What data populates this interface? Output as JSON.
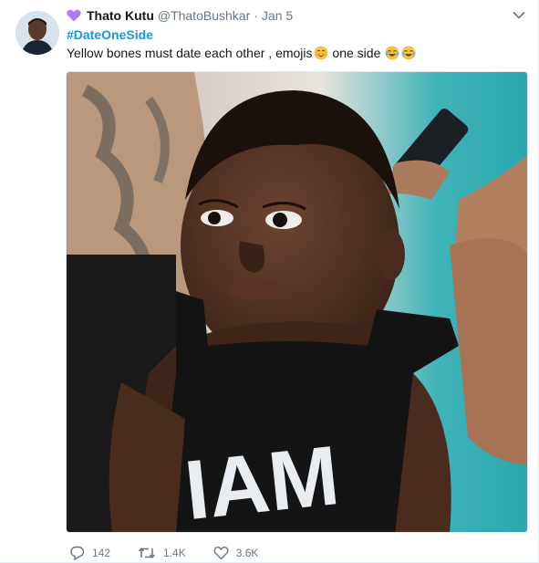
{
  "tweet": {
    "author_name": "Thato Kutu",
    "author_handle": "@ThatoBushkar",
    "separator": "·",
    "timestamp": "Jan 5",
    "hashtag": "#DateOneSide",
    "text_part1": "Yellow bones must date each other , emojis",
    "text_part2": " one side ",
    "photo_caption": "IAM",
    "actions": {
      "replies": "142",
      "retweets": "1.4K",
      "likes": "3.6K"
    }
  },
  "icons": {
    "name_badge": "purple-heart-icon",
    "menu": "chevron-down-icon",
    "reply": "reply-icon",
    "retweet": "retweet-icon",
    "like": "heart-outline-icon"
  },
  "colors": {
    "hashtag": "#1b95e0",
    "secondary_text": "#657786",
    "badge": "#ab7df8"
  }
}
